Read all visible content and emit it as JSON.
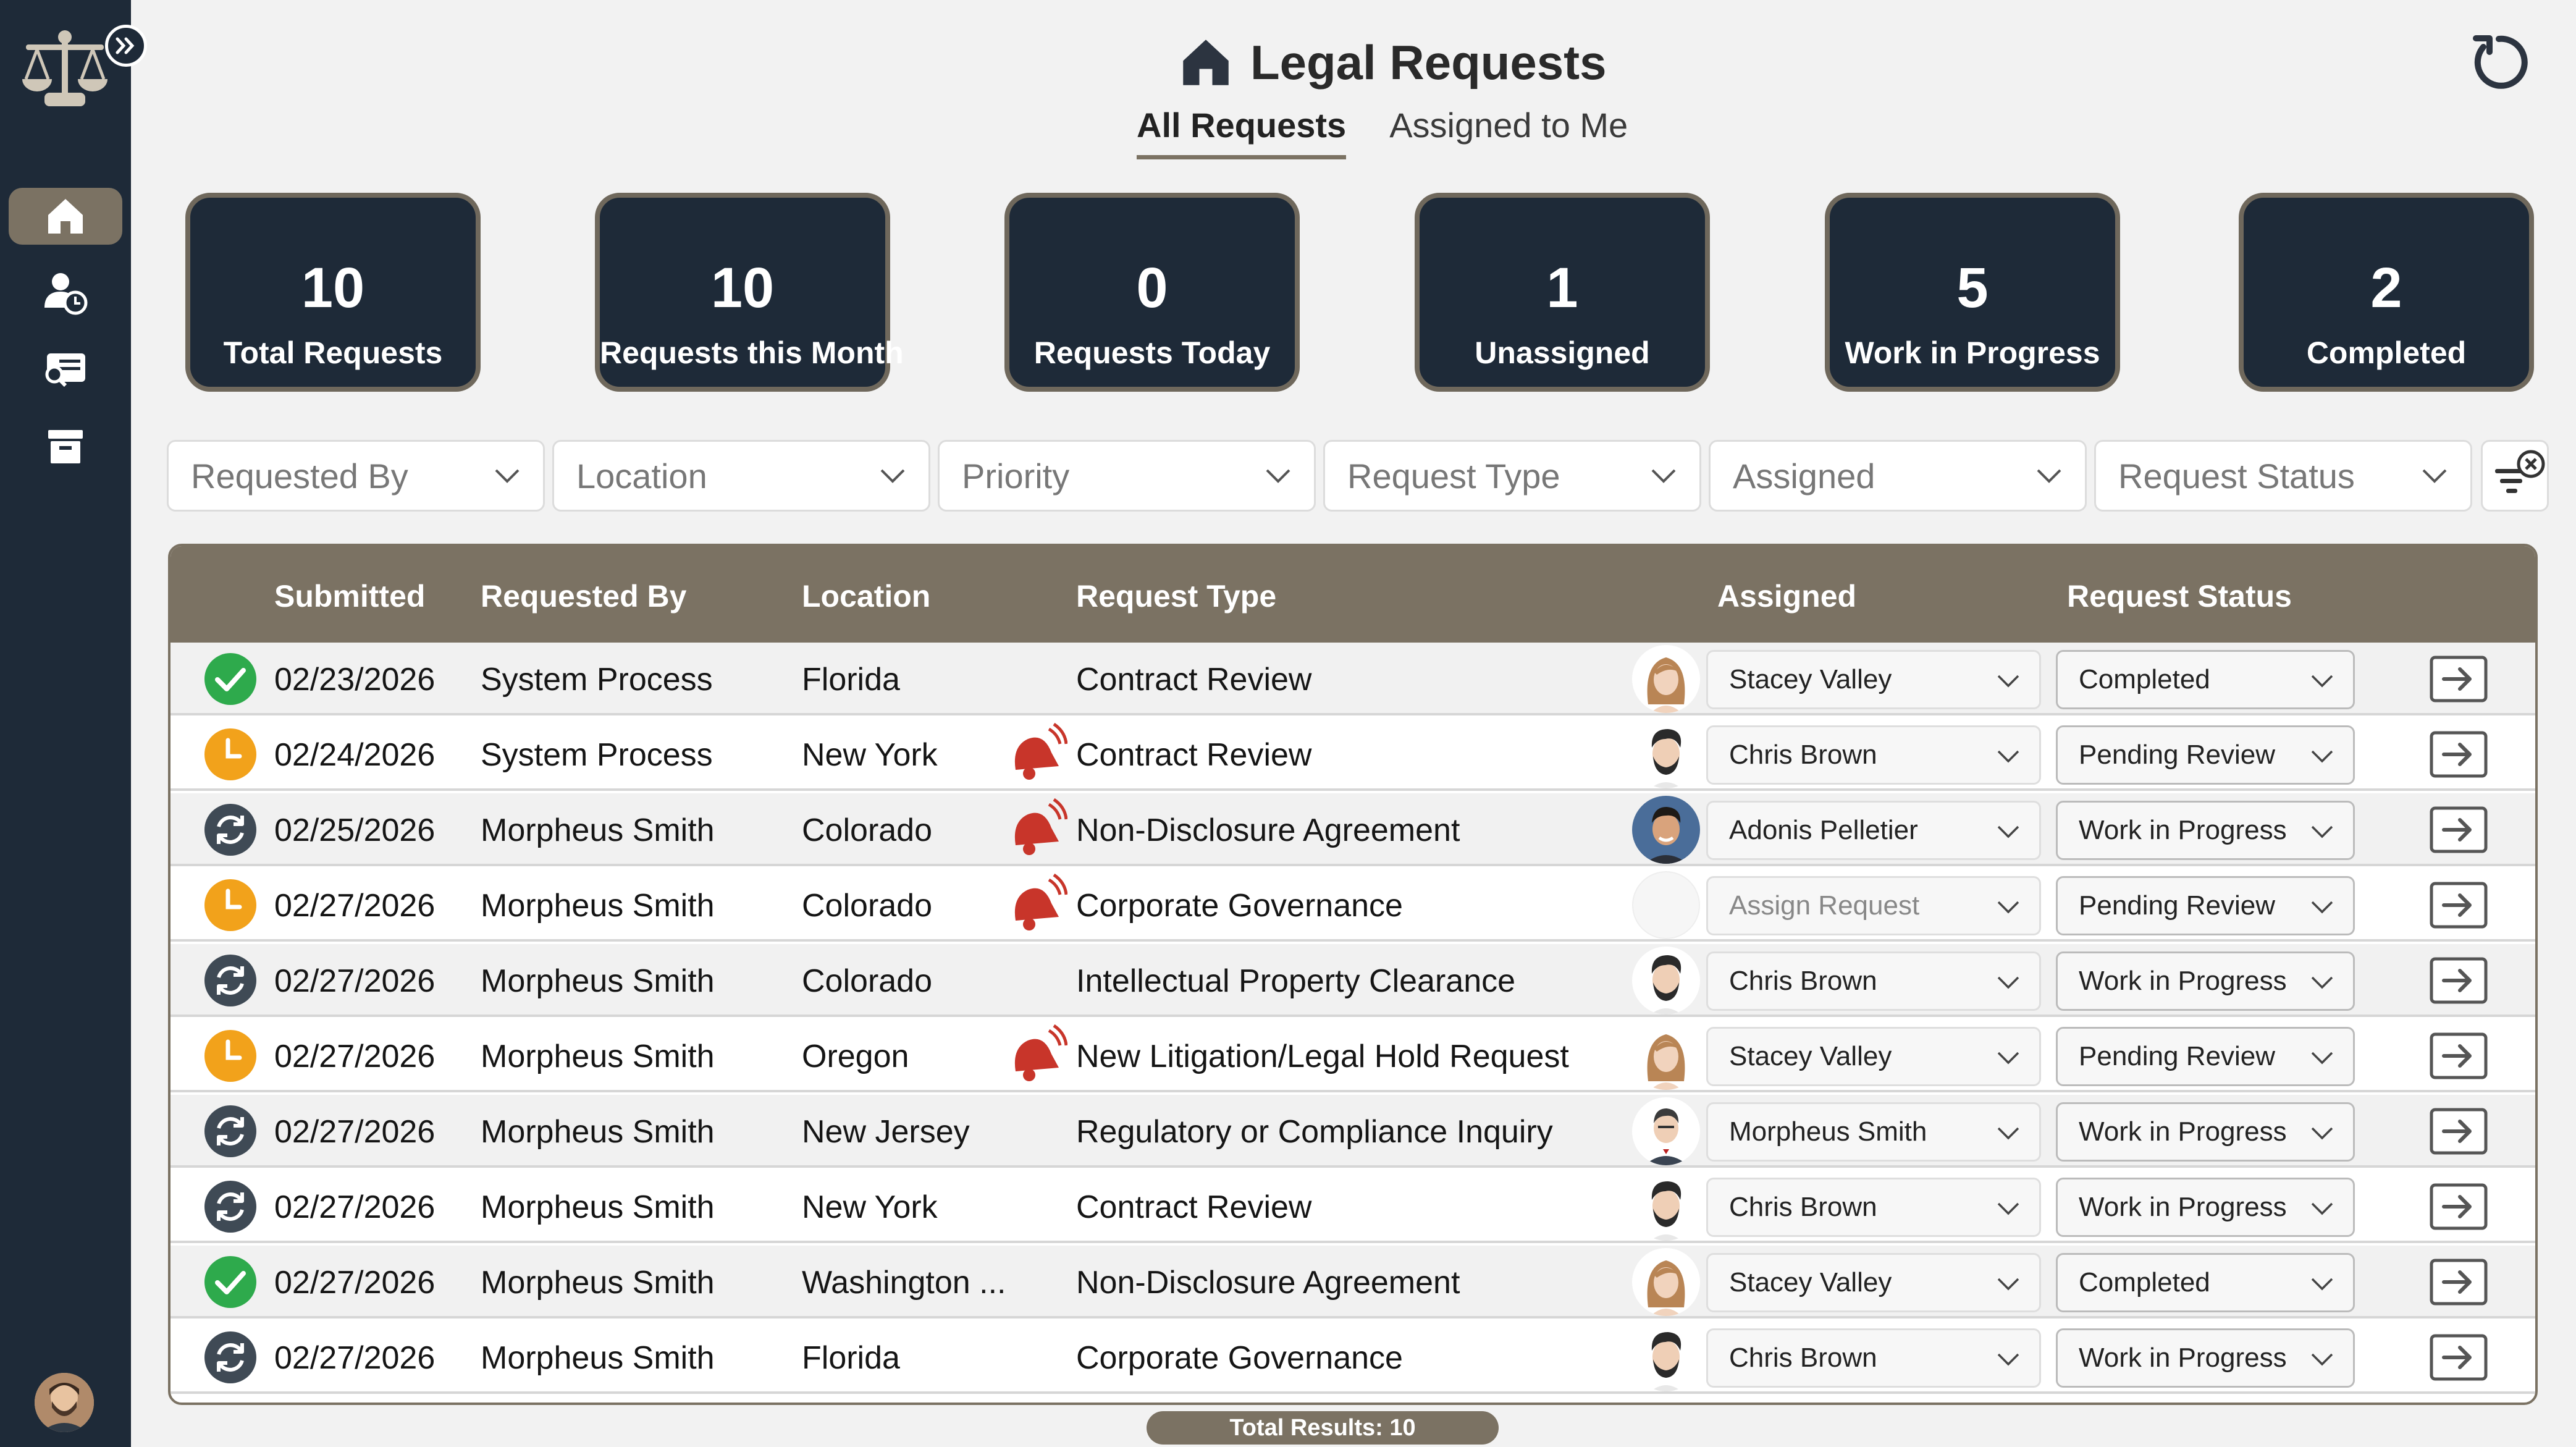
{
  "app": {
    "title": "Legal Requests",
    "tabs": [
      {
        "label": "All Requests",
        "active": true
      },
      {
        "label": "Assigned to Me",
        "active": false
      }
    ]
  },
  "sidebar": {
    "items": [
      {
        "icon": "home-icon",
        "active": true
      },
      {
        "icon": "user-clock-icon",
        "active": false
      },
      {
        "icon": "search-list-icon",
        "active": false
      },
      {
        "icon": "archive-icon",
        "active": false
      }
    ]
  },
  "stats": [
    {
      "value": "10",
      "label": "Total Requests"
    },
    {
      "value": "10",
      "label": "Requests this Month"
    },
    {
      "value": "0",
      "label": "Requests Today"
    },
    {
      "value": "1",
      "label": "Unassigned"
    },
    {
      "value": "5",
      "label": "Work in Progress"
    },
    {
      "value": "2",
      "label": "Completed"
    }
  ],
  "filters": [
    {
      "placeholder": "Requested By"
    },
    {
      "placeholder": "Location"
    },
    {
      "placeholder": "Priority"
    },
    {
      "placeholder": "Request Type"
    },
    {
      "placeholder": "Assigned"
    },
    {
      "placeholder": "Request Status"
    }
  ],
  "table": {
    "headers": {
      "submitted": "Submitted",
      "requested_by": "Requested By",
      "location": "Location",
      "request_type": "Request Type",
      "assigned": "Assigned",
      "status": "Request Status"
    },
    "rows": [
      {
        "state": "completed",
        "submitted": "02/23/2026",
        "requested_by": "System Process",
        "location": "Florida",
        "urgent": false,
        "request_type": "Contract Review",
        "assignee_face": "woman",
        "assigned": "Stacey Valley",
        "status": "Completed"
      },
      {
        "state": "pending",
        "submitted": "02/24/2026",
        "requested_by": "System Process",
        "location": "New York",
        "urgent": true,
        "request_type": "Contract Review",
        "assignee_face": "man-beard",
        "assigned": "Chris Brown",
        "status": "Pending Review"
      },
      {
        "state": "progress",
        "submitted": "02/25/2026",
        "requested_by": "Morpheus Smith",
        "location": "Colorado",
        "urgent": true,
        "request_type": "Non-Disclosure Agreement",
        "assignee_face": "man-photo",
        "assigned": "Adonis Pelletier",
        "status": "Work in Progress"
      },
      {
        "state": "pending",
        "submitted": "02/27/2026",
        "requested_by": "Morpheus Smith",
        "location": "Colorado",
        "urgent": true,
        "request_type": "Corporate Governance",
        "assignee_face": "none",
        "assigned": "Assign Request",
        "status": "Pending Review"
      },
      {
        "state": "progress",
        "submitted": "02/27/2026",
        "requested_by": "Morpheus Smith",
        "location": "Colorado",
        "urgent": false,
        "request_type": "Intellectual Property Clearance",
        "assignee_face": "man-beard",
        "assigned": "Chris Brown",
        "status": "Work in Progress"
      },
      {
        "state": "pending",
        "submitted": "02/27/2026",
        "requested_by": "Morpheus Smith",
        "location": "Oregon",
        "urgent": true,
        "request_type": "New Litigation/Legal Hold Request",
        "assignee_face": "woman",
        "assigned": "Stacey Valley",
        "status": "Pending Review"
      },
      {
        "state": "progress",
        "submitted": "02/27/2026",
        "requested_by": "Morpheus Smith",
        "location": "New Jersey",
        "urgent": false,
        "request_type": "Regulatory or Compliance Inquiry",
        "assignee_face": "man-suit",
        "assigned": "Morpheus Smith",
        "status": "Work in Progress"
      },
      {
        "state": "progress",
        "submitted": "02/27/2026",
        "requested_by": "Morpheus Smith",
        "location": "New York",
        "urgent": false,
        "request_type": "Contract Review",
        "assignee_face": "man-beard",
        "assigned": "Chris Brown",
        "status": "Work in Progress"
      },
      {
        "state": "completed",
        "submitted": "02/27/2026",
        "requested_by": "Morpheus Smith",
        "location": "Washington ...",
        "urgent": false,
        "request_type": "Non-Disclosure Agreement",
        "assignee_face": "woman",
        "assigned": "Stacey Valley",
        "status": "Completed"
      },
      {
        "state": "progress",
        "submitted": "02/27/2026",
        "requested_by": "Morpheus Smith",
        "location": "Florida",
        "urgent": false,
        "request_type": "Corporate Governance",
        "assignee_face": "man-beard",
        "assigned": "Chris Brown",
        "status": "Work in Progress"
      }
    ]
  },
  "footer": {
    "total": "Total Results: 10"
  },
  "colors": {
    "sidebar": "#1e2a38",
    "accent": "#7b7263",
    "completed": "#2eaa4c",
    "pending": "#f2a21b",
    "progress": "#3f4a55",
    "urgent": "#c8352a"
  }
}
